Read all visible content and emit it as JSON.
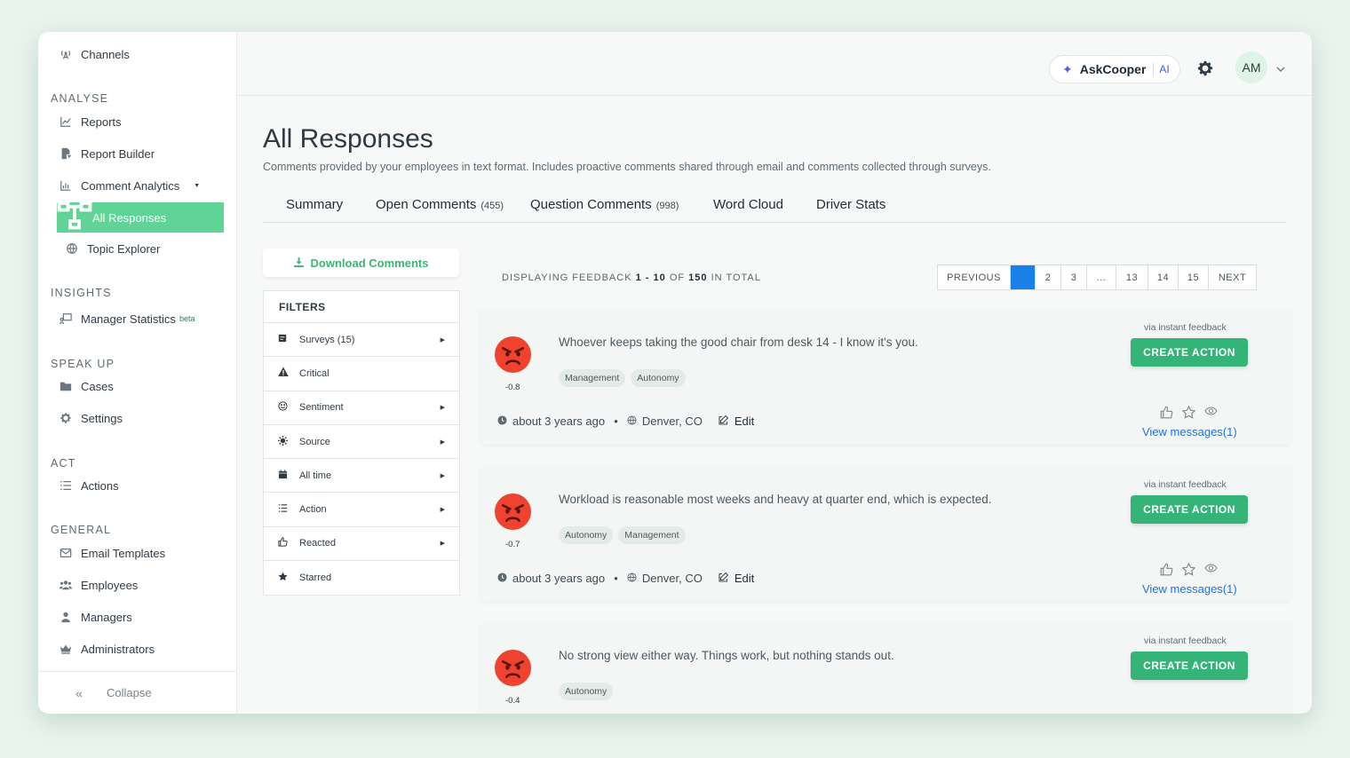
{
  "sidebar": {
    "top_item": "Channels",
    "sections": {
      "analyse": "ANALYSE",
      "insights": "INSIGHTS",
      "speak_up": "SPEAK UP",
      "act": "ACT",
      "general": "GENERAL"
    },
    "items": {
      "reports": "Reports",
      "report_builder": "Report Builder",
      "comment_analytics": "Comment Analytics",
      "all_responses": "All Responses",
      "topic_explorer": "Topic Explorer",
      "manager_statistics": "Manager Statistics",
      "manager_statistics_badge": "beta",
      "cases": "Cases",
      "settings": "Settings",
      "actions": "Actions",
      "email_templates": "Email Templates",
      "employees": "Employees",
      "managers": "Managers",
      "administrators": "Administrators"
    },
    "collapse": "Collapse"
  },
  "header": {
    "askcooper": "AskCooper",
    "ai_badge": "AI",
    "avatar_initials": "AM"
  },
  "page": {
    "title": "All Responses",
    "subtitle": "Comments provided by your employees in text format. Includes proactive comments shared through email and comments collected through surveys."
  },
  "tabs": [
    {
      "label": "Summary",
      "count": ""
    },
    {
      "label": "Open Comments",
      "count": "(455)"
    },
    {
      "label": "Question Comments",
      "count": "(998)"
    },
    {
      "label": "Word Cloud",
      "count": ""
    },
    {
      "label": "Driver Stats",
      "count": ""
    }
  ],
  "download": "Download Comments",
  "filters": {
    "title": "FILTERS",
    "rows": [
      {
        "label": "Surveys (15)",
        "icon": "survey-icon"
      },
      {
        "label": "Critical",
        "icon": "warning-icon"
      },
      {
        "label": "Sentiment",
        "icon": "smile-icon"
      },
      {
        "label": "Source",
        "icon": "source-icon"
      },
      {
        "label": "All time",
        "icon": "calendar-icon"
      },
      {
        "label": "Action",
        "icon": "list-icon"
      },
      {
        "label": "Reacted",
        "icon": "thumbs-up-icon"
      },
      {
        "label": "Starred",
        "icon": "star-icon"
      }
    ]
  },
  "pagination": {
    "prefix": "DISPLAYING FEEDBACK",
    "range": "1 - 10",
    "of": "OF",
    "total": "150",
    "suffix": "IN TOTAL",
    "previous": "PREVIOUS",
    "pages": [
      "1",
      "2",
      "3",
      "...",
      "13",
      "14",
      "15"
    ],
    "current_page": "1",
    "next": "NEXT"
  },
  "feedback": [
    {
      "score": "-0.8",
      "text": "Whoever keeps taking the good chair from desk 14 - I know it's you.",
      "tags": [
        "Management",
        "Autonomy"
      ],
      "time": "about 3 years ago",
      "location": "Denver, CO",
      "edit": "Edit",
      "via": "via instant feedback",
      "action": "CREATE ACTION",
      "messages": "View messages(1)"
    },
    {
      "score": "-0.7",
      "text": "Workload is reasonable most weeks and heavy at quarter end, which is expected.",
      "tags": [
        "Autonomy",
        "Management"
      ],
      "time": "about 3 years ago",
      "location": "Denver, CO",
      "edit": "Edit",
      "via": "via instant feedback",
      "action": "CREATE ACTION",
      "messages": "View messages(1)"
    },
    {
      "score": "-0.4",
      "text": "No strong view either way. Things work, but nothing stands out.",
      "tags": [
        "Autonomy"
      ],
      "via": "via instant feedback",
      "action": "CREATE ACTION"
    }
  ],
  "colors": {
    "accent_green": "#5fd496",
    "action_green": "#35b478",
    "link_blue": "#1a73e8",
    "page_active_blue": "#1a7fe6",
    "emoji_red": "#f0432f"
  }
}
